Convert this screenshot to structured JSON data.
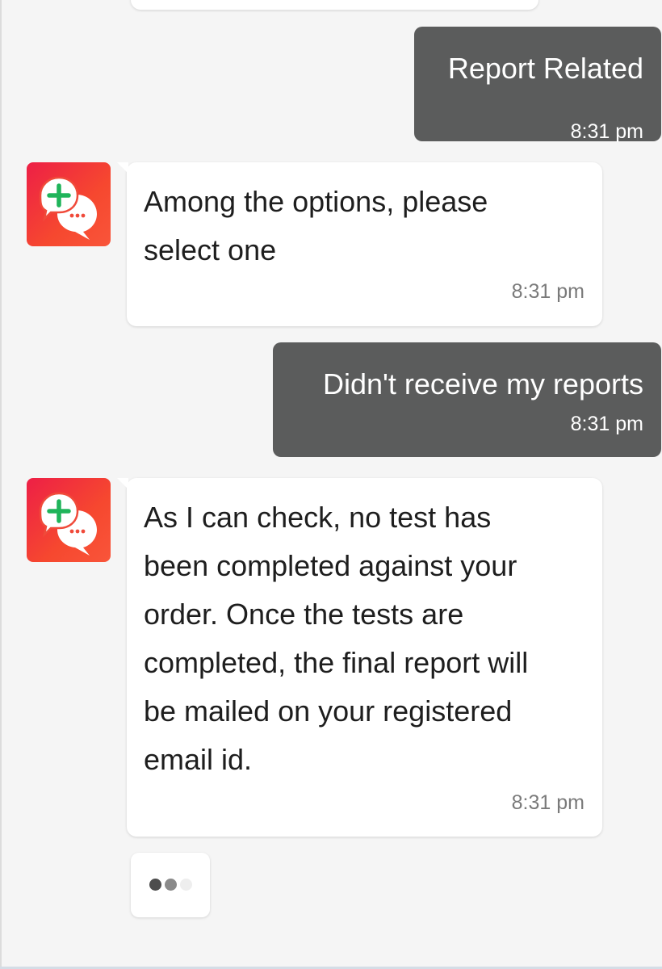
{
  "messages": [
    {
      "sender": "user",
      "text": "Report Related",
      "time": "8:31 pm"
    },
    {
      "sender": "bot",
      "text_lines": [
        "Among the options, please",
        "select one"
      ],
      "time": "8:31 pm"
    },
    {
      "sender": "user",
      "text": "Didn't receive my reports",
      "time": "8:31 pm"
    },
    {
      "sender": "bot",
      "text_lines": [
        "As I can check, no test has",
        "been completed against your",
        "order. Once the tests are",
        "completed, the final report will",
        "be mailed on your registered",
        "email id."
      ],
      "time": "8:31 pm"
    }
  ],
  "typing_indicator": {
    "dot_colors": [
      "#4d4d4d",
      "#8a8a8a",
      "#eeeeee"
    ]
  },
  "colors": {
    "user_bubble": "#5b5c5c",
    "bot_bubble": "#ffffff",
    "background": "#f5f5f5",
    "avatar_gradient_start": "#ed1f46",
    "avatar_gradient_end": "#f9553a",
    "plus_green": "#1fb45a"
  },
  "icons": {
    "bot_avatar": "chat-bubbles-plus-icon"
  }
}
